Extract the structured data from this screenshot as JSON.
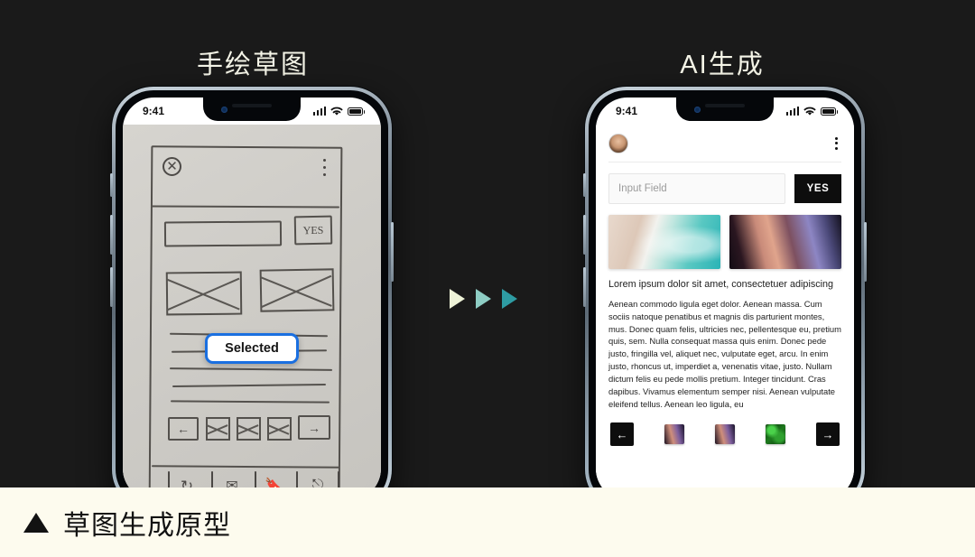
{
  "theme": {
    "background": "#1a1a1a",
    "banner_bg": "#fdfbee",
    "accent_teal": "#2e9ca3",
    "accent_cream": "#f0f5dc",
    "selected_border": "#1a6fe0"
  },
  "columns": {
    "left_title": "手绘草图",
    "right_title": "AI生成"
  },
  "arrows": {
    "colors": [
      "#eef3d8",
      "#8ecdc4",
      "#2e9ca3"
    ],
    "count": 3
  },
  "left_phone": {
    "status": {
      "time": "9:41",
      "signal_icon": "cellular-bars-icon",
      "wifi_icon": "wifi-icon",
      "battery_icon": "battery-icon"
    },
    "sketch": {
      "avatar_icon": "sketch-avatar-x-icon",
      "kebab_icon": "sketch-kebab-icon",
      "input_box": "sketch-input-box",
      "yes_button": "YES",
      "image_placeholders": 2,
      "text_lines": 5,
      "nav_icons": [
        "arrow-left",
        "x-box",
        "x-box",
        "x-box",
        "arrow-right"
      ],
      "toolbar_icons": [
        "refresh",
        "mail",
        "bookmark",
        "share"
      ]
    },
    "overlay_badge": "Selected"
  },
  "right_phone": {
    "status": {
      "time": "9:41",
      "signal_icon": "cellular-bars-icon",
      "wifi_icon": "wifi-icon",
      "battery_icon": "battery-icon"
    },
    "topbar": {
      "avatar": "user-avatar",
      "menu_icon": "kebab-menu-icon"
    },
    "input": {
      "placeholder": "Input Field",
      "value": ""
    },
    "yes_button": "YES",
    "thumbnails": [
      "beach-aerial-photo",
      "slot-canyon-photo"
    ],
    "caption": "Lorem ipsum dolor sit amet, consectetuer adipiscing",
    "body": "Aenean commodo ligula eget dolor. Aenean massa. Cum sociis natoque penatibus et magnis dis parturient montes, mus. Donec quam felis, ultricies nec, pellentesque eu, pretium quis, sem. Nulla consequat massa quis enim. Donec pede justo, fringilla vel, aliquet nec, vulputate eget, arcu. In enim justo, rhoncus ut, imperdiet a, venenatis vitae, justo. Nullam dictum felis eu pede mollis pretium. Integer tincidunt. Cras dapibus. Vivamus elementum semper nisi. Aenean vulputate eleifend tellus. Aenean leo ligula, eu",
    "bottom_bar": {
      "prev_icon": "←",
      "next_icon": "→",
      "thumbs": [
        "canyon",
        "canyon",
        "green"
      ]
    }
  },
  "banner": {
    "marker_icon": "triangle-marker-icon",
    "text": "草图生成原型"
  }
}
